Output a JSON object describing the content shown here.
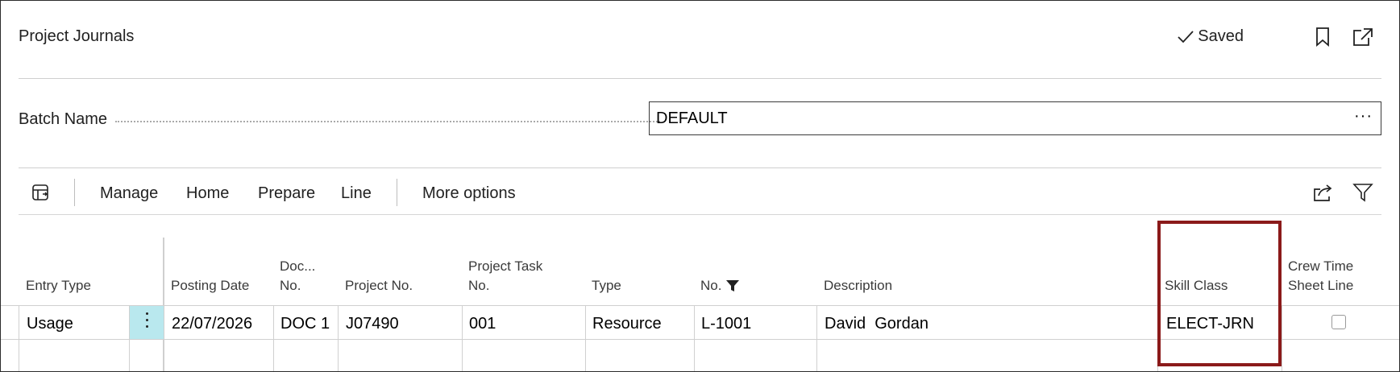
{
  "header": {
    "title": "Project Journals",
    "status": "Saved"
  },
  "batch": {
    "label": "Batch Name",
    "value": "DEFAULT",
    "ellipsis": "···"
  },
  "toolbar": {
    "items": [
      "Manage",
      "Home",
      "Prepare",
      "Line"
    ],
    "more": "More options"
  },
  "columns": {
    "entry_type": "Entry Type",
    "posting_date": "Posting Date",
    "doc_no": [
      "Doc...",
      "No."
    ],
    "project_no": "Project No.",
    "project_task_no": [
      "Project Task",
      "No."
    ],
    "type": "Type",
    "no": "No.",
    "description": "Description",
    "skill_class": "Skill Class",
    "crew_time_sheet_line": [
      "Crew Time",
      "Sheet Line"
    ]
  },
  "rows": [
    {
      "entry_type": "Usage",
      "posting_date": "22/07/2026",
      "doc_no": "DOC 1",
      "project_no": "J07490",
      "project_task_no": "001",
      "type": "Resource",
      "no": "L-1001",
      "description": "David  Gordan",
      "skill_class": "ELECT-JRN",
      "crew_time_sheet_line": false
    }
  ],
  "colors": {
    "highlight": "#8b1a1a",
    "row_action": "#b9e8ee"
  }
}
